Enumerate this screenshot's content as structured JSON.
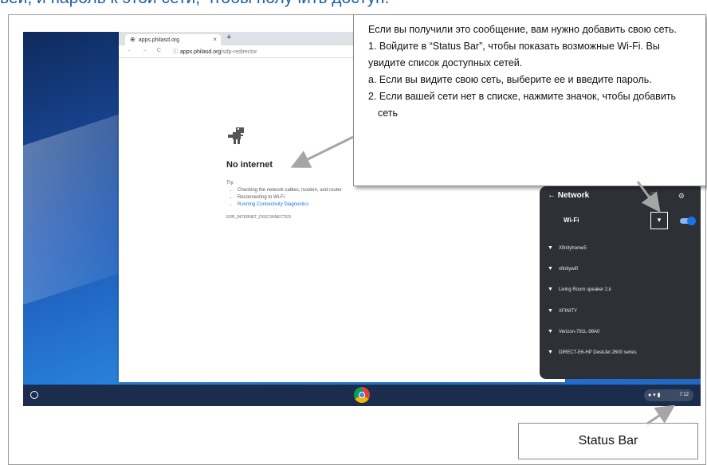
{
  "page": {
    "heading": "вей, и пароль к этой сети, чтобы получить доступ."
  },
  "browser": {
    "tab_title": "apps.philasd.org",
    "tab_close": "×",
    "new_tab": "+",
    "nav_icons": "← → C",
    "url_host": "apps.philasd.org",
    "url_path": "/sdp-redirector",
    "error_title": "No internet",
    "try_label": "Try:",
    "suggestions": [
      "Checking the network cables, modem, and router",
      "Reconnecting to Wi-Fi",
      "Running Connectivity Diagnostics"
    ],
    "error_code": "ERR_INTERNET_DISCONNECTED"
  },
  "network_panel": {
    "title": "← Network",
    "icons": "ⓘ ⚙",
    "wifi_label": "Wi-Fi",
    "networks": [
      "Xfinityhome5",
      "xfinitywifi",
      "Living Room speaker 2.k",
      "XFINITY",
      "Verizon-791L-98A0",
      "DIRECT-E6-HP DeskJet 2600 series"
    ]
  },
  "shelf": {
    "time": "7:12"
  },
  "callout": {
    "lines": [
      "Если вы получили это сообщение, вам нужно  добавить свою сеть.",
      "1. Войдите в “Status Bar”, чтобы показать возможные Wi-Fi. Вы увидите список доступных сетей.",
      "а. Если вы видите свою сеть, выберите ее и введите пароль.",
      "2. Если вашей сети нет в списке, нажмите значок, чтобы добавить сеть"
    ]
  },
  "status_label": "Status Bar",
  "colors": {
    "heading": "#1f5fa6",
    "link": "#1a73e8",
    "panel_bg": "#2d3035",
    "shelf_bg": "#1b2c4d"
  }
}
